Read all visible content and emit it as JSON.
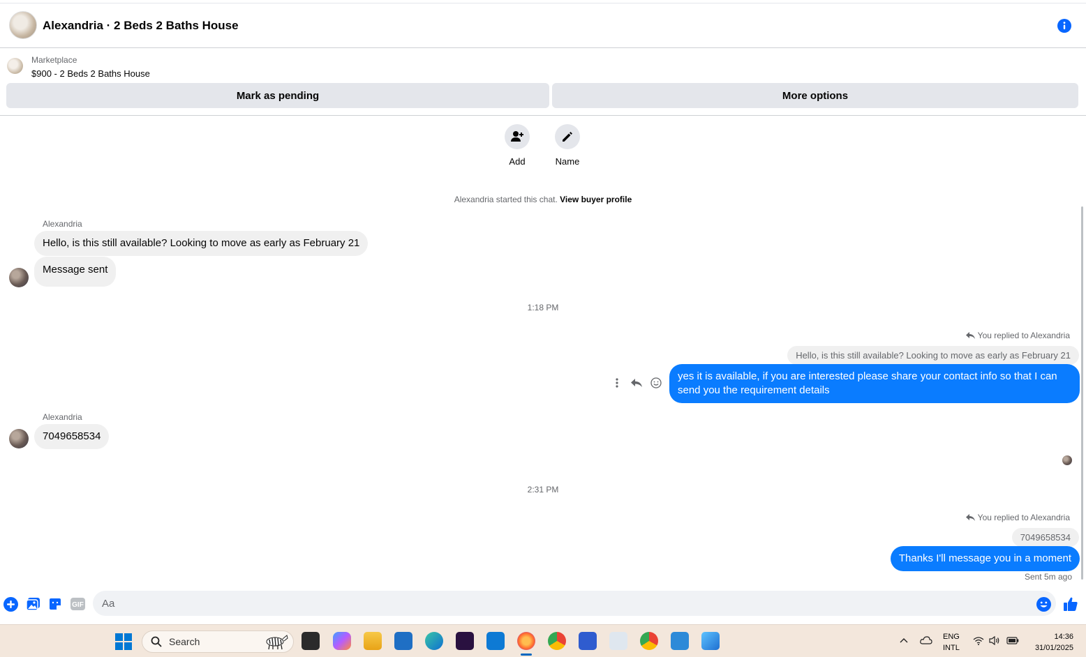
{
  "header": {
    "title": "Alexandria · 2 Beds 2 Baths House",
    "info_icon": "info-icon"
  },
  "marketplace": {
    "label": "Marketplace",
    "listing": "$900 - 2 Beds 2 Baths House",
    "mark_pending_label": "Mark as pending",
    "more_options_label": "More options"
  },
  "actions": {
    "add_label": "Add",
    "name_label": "Name"
  },
  "chat": {
    "started_text": "Alexandria started this chat.",
    "view_profile_link": "View buyer profile",
    "messages": {
      "m1_sender": "Alexandria",
      "m1_text": "Hello, is this still available? Looking to move as early as February 21",
      "m2_text": "Message sent",
      "time1": "1:18 PM",
      "reply1_note": "You replied to Alexandria",
      "reply1_quote": "Hello, is this still available? Looking to move as early as February 21",
      "reply1_text": "yes it is available, if you are interested please share your contact info so that I can send you the requirement details",
      "m3_sender": "Alexandria",
      "m3_text": "7049658534",
      "time2": "2:31 PM",
      "reply2_note": "You replied to Alexandria",
      "reply2_quote": "7049658534",
      "reply2_text": "Thanks I'll message you in a moment",
      "sent_status": "Sent 5m ago"
    }
  },
  "composer": {
    "placeholder": "Aa"
  },
  "taskbar": {
    "search_label": "Search",
    "lang_line1": "ENG",
    "lang_line2": "INTL",
    "time": "14:36",
    "date": "31/01/2025"
  },
  "colors": {
    "accent": "#0a7cff",
    "messenger_blue": "#0866ff"
  }
}
